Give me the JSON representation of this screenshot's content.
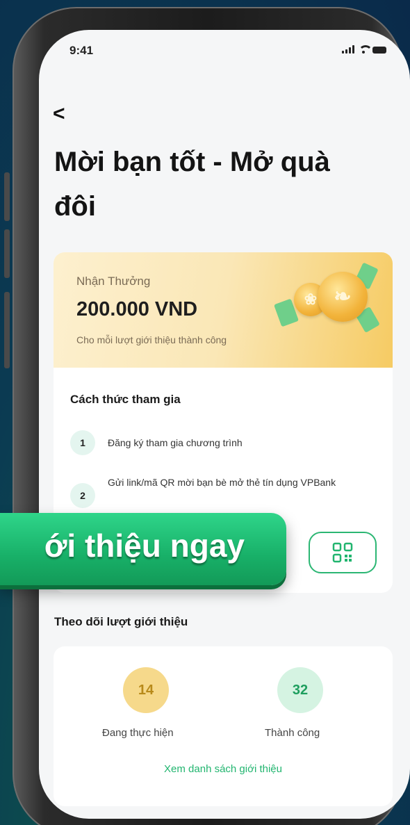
{
  "status_bar": {
    "time": "9:41"
  },
  "header": {
    "back_glyph": "<",
    "title": "Mời bạn tốt - Mở quà đôi"
  },
  "reward": {
    "label": "Nhận Thưởng",
    "amount": "200.000 VND",
    "subtitle": "Cho mỗi lượt giới thiệu thành công"
  },
  "how_to": {
    "title": "Cách thức tham gia",
    "steps": [
      {
        "number": "1",
        "text": "Đăng ký tham gia chương trình"
      },
      {
        "number": "2",
        "text": "Gửi link/mã QR mời bạn bè mở thẻ tín dụng VPBank"
      }
    ]
  },
  "cta": {
    "label": "ới thiệu ngay",
    "qr_icon": "qr-code-icon"
  },
  "tracking": {
    "title": "Theo dõi lượt giới thiệu",
    "stats": [
      {
        "value": "14",
        "label": "Đang thực hiện",
        "color": "#f6d98b"
      },
      {
        "value": "32",
        "label": "Thành công",
        "color": "#d5f3e2"
      }
    ],
    "view_list_label": "Xem danh sách giới thiệu"
  },
  "colors": {
    "accent_green": "#21b56f",
    "reward_gold": "#f6cb63"
  }
}
